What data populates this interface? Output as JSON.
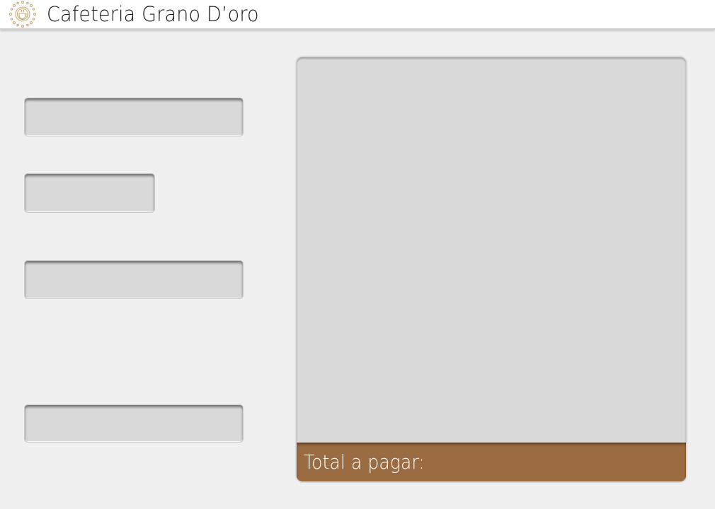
{
  "header": {
    "title": "Cafeteria Grano D’oro",
    "logo_icon": "coffee-sun-logo-icon"
  },
  "form": {
    "fields": [
      {
        "name": "field-1",
        "value": "",
        "placeholder": ""
      },
      {
        "name": "field-2",
        "value": "",
        "placeholder": ""
      },
      {
        "name": "field-3",
        "value": "",
        "placeholder": ""
      },
      {
        "name": "field-4",
        "value": "",
        "placeholder": ""
      }
    ]
  },
  "order": {
    "total_label": "Total a pagar:",
    "items": []
  },
  "colors": {
    "background": "#f0f0f0",
    "field": "#d9d9d9",
    "total_bar": "#9b6c41",
    "logo": "#c9a36b"
  }
}
